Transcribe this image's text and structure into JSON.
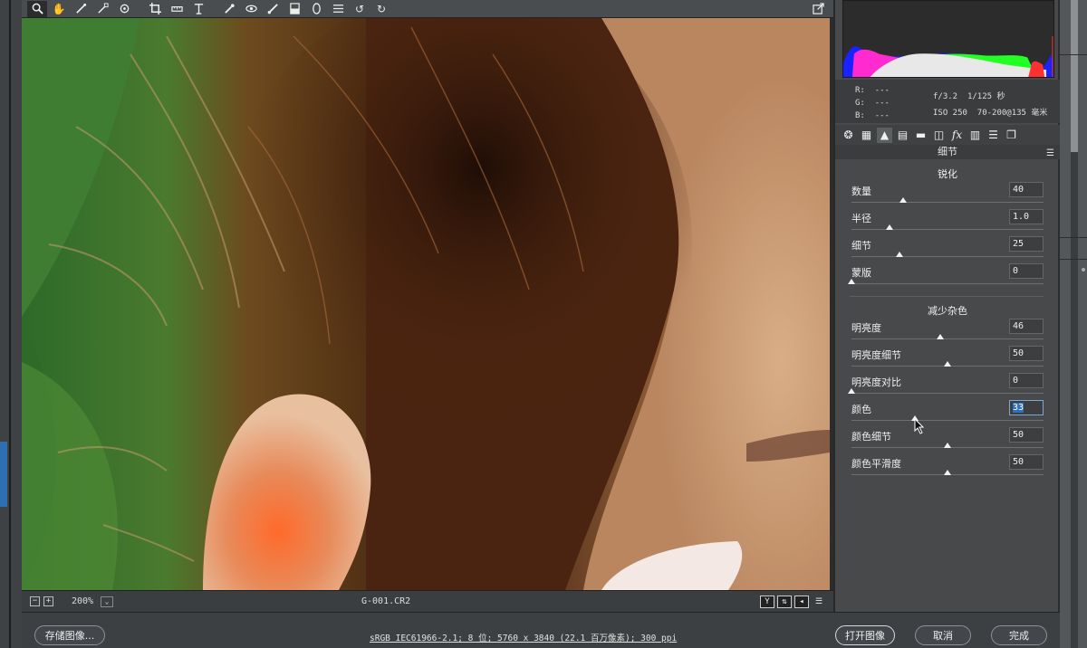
{
  "toolbar": {
    "tools": [
      "zoom-icon",
      "hand-icon",
      "white-balance-icon",
      "color-sampler-icon",
      "target-adjust-icon",
      "crop-icon",
      "straighten-icon",
      "transform-icon",
      "spot-removal-icon",
      "red-eye-icon",
      "adjustment-brush-icon",
      "graduated-filter-icon",
      "radial-filter-icon",
      "preferences-icon",
      "rotate-ccw-icon",
      "rotate-cw-icon"
    ],
    "fullscreen_icon": "fullscreen-icon"
  },
  "info": {
    "r_label": "R:",
    "g_label": "G:",
    "b_label": "B:",
    "r_val": "---",
    "g_val": "---",
    "b_val": "---",
    "aperture": "f/3.2",
    "shutter": "1/125 秒",
    "iso": "ISO 250",
    "lens": "70-200@135 毫米"
  },
  "panel": {
    "section_title": "细节",
    "sharpen_title": "锐化",
    "noise_title": "减少杂色",
    "sharpen": [
      {
        "label": "数量",
        "value": "40",
        "pos": 0.27
      },
      {
        "label": "半径",
        "value": "1.0",
        "pos": 0.2
      },
      {
        "label": "细节",
        "value": "25",
        "pos": 0.25
      },
      {
        "label": "蒙版",
        "value": "0",
        "pos": 0.0
      }
    ],
    "noise": [
      {
        "label": "明亮度",
        "value": "46",
        "pos": 0.46
      },
      {
        "label": "明亮度细节",
        "value": "50",
        "pos": 0.5
      },
      {
        "label": "明亮度对比",
        "value": "0",
        "pos": 0.0
      },
      {
        "label": "颜色",
        "value": "33",
        "pos": 0.33,
        "focused": true
      },
      {
        "label": "颜色细节",
        "value": "50",
        "pos": 0.5
      },
      {
        "label": "颜色平滑度",
        "value": "50",
        "pos": 0.5
      }
    ]
  },
  "status": {
    "zoom_out": "−",
    "zoom_in": "+",
    "zoom": "200%",
    "filename": "G-001.CR2"
  },
  "bottom": {
    "save": "存储图像...",
    "workflow": "sRGB IEC61966-2.1; 8 位; 5760 x 3840 (22.1 百万像素); 300 ppi",
    "open": "打开图像",
    "cancel": "取消",
    "done": "完成"
  }
}
